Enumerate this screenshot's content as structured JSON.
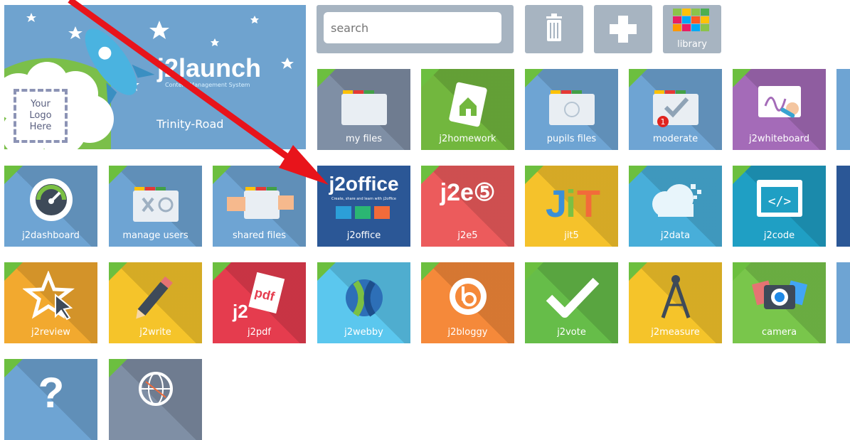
{
  "banner": {
    "brand": "j2launch",
    "tagline": "Content Management System",
    "school": "Trinity-Road",
    "logo_placeholder": [
      "Your",
      "Logo",
      "Here"
    ]
  },
  "search": {
    "placeholder": "search"
  },
  "toolbar": {
    "library_label": "library"
  },
  "tiles": [
    {
      "label": "my files",
      "color": "#7f8fa5"
    },
    {
      "label": "j2homework",
      "color": "#72b73e"
    },
    {
      "label": "pupils files",
      "color": "#6ea4d3"
    },
    {
      "label": "moderate",
      "color": "#6ea4d3",
      "badge": "1"
    },
    {
      "label": "j2whiteboard",
      "color": "#a46bb8"
    },
    {
      "label": "j2dashboard",
      "color": "#6ea4d3"
    },
    {
      "label": "manage users",
      "color": "#6ea4d3"
    },
    {
      "label": "shared files",
      "color": "#6ea4d3"
    },
    {
      "label": "j2office",
      "color": "#2b5796",
      "logo": "j2office",
      "subtitle": "Create, share and learn with j2office"
    },
    {
      "label": "j2e5",
      "color": "#ec5b5c",
      "logo": "j2e⑤"
    },
    {
      "label": "jit5",
      "color": "#f5c22b",
      "logo": "JiT"
    },
    {
      "label": "j2data",
      "color": "#48aed9"
    },
    {
      "label": "j2code",
      "color": "#1f9fc4"
    },
    {
      "label": "j2review",
      "color": "#f2a92f"
    },
    {
      "label": "j2write",
      "color": "#f5c42a"
    },
    {
      "label": "j2pdf",
      "color": "#e53c4e"
    },
    {
      "label": "j2webby",
      "color": "#5bc7ee"
    },
    {
      "label": "j2bloggy",
      "color": "#f5893a"
    },
    {
      "label": "j2vote",
      "color": "#66bd49"
    },
    {
      "label": "j2measure",
      "color": "#f5c42a"
    },
    {
      "label": "camera",
      "color": "#79c64b"
    },
    {
      "label": "",
      "color": "#6ea4d3"
    },
    {
      "label": "",
      "color": "#7f8fa5"
    }
  ],
  "colors": {
    "accent_green": "#6cbf3f",
    "arrow_red": "#e8141b"
  }
}
